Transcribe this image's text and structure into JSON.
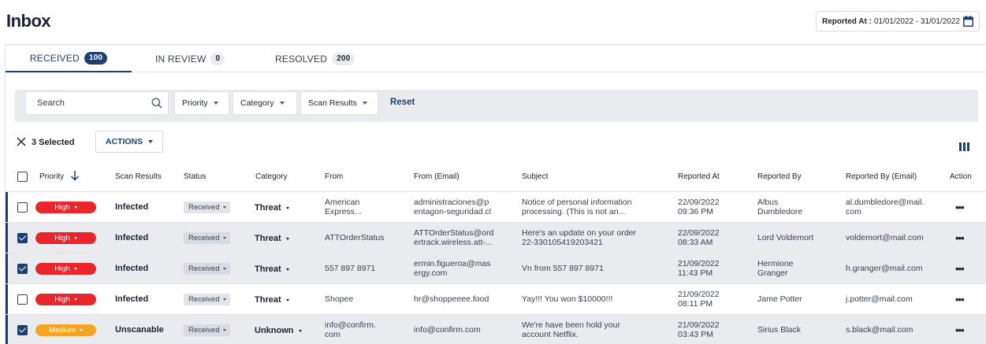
{
  "header": {
    "title": "Inbox",
    "reported_at_label": "Reported At :",
    "reported_at_value": "01/01/2022 - 31/01/2022",
    "calendar_icon": "calendar-icon"
  },
  "tabs": [
    {
      "label": "RECEIVED",
      "count": "100",
      "active": true
    },
    {
      "label": "IN REVIEW",
      "count": "0",
      "active": false
    },
    {
      "label": "RESOLVED",
      "count": "200",
      "active": false
    }
  ],
  "filters": {
    "search_placeholder": "Search",
    "priority_label": "Priority",
    "category_label": "Category",
    "scan_results_label": "Scan Results",
    "reset_label": "Reset"
  },
  "selection": {
    "selected_text": "3 Selected",
    "actions_label": "ACTIONS"
  },
  "columns": [
    "Priority",
    "Scan Results",
    "Status",
    "Category",
    "From",
    "From (Email)",
    "Subject",
    "Reported At",
    "Reported By",
    "Reported By (Email)",
    "Action"
  ],
  "rows": [
    {
      "checked": false,
      "priority": "High",
      "priority_color": "#e8262b",
      "scan": "Infected",
      "status": "Received",
      "category": "Threat",
      "from": [
        "American",
        "Express..."
      ],
      "from_email": [
        "administraciones@p",
        "entagon-seguridad.cl"
      ],
      "subject": [
        "Notice of personal information",
        "processing. (This is not an..."
      ],
      "reported_at": [
        "22/09/2022",
        "09:36 PM"
      ],
      "reported_by": [
        "Albus",
        "Dumbledore"
      ],
      "reported_by_email": [
        "al.dumbledore@mail.",
        "com"
      ]
    },
    {
      "checked": true,
      "priority": "High",
      "priority_color": "#e8262b",
      "scan": "Infected",
      "status": "Received",
      "category": "Threat",
      "from": [
        "ATTOrderStatus"
      ],
      "from_email": [
        "ATTOrderStatus@ord",
        "ertrack.wireless.att-..."
      ],
      "subject": [
        "Here's an update on your order",
        "22-330105419203421"
      ],
      "reported_at": [
        "22/09/2022",
        "08:33 AM"
      ],
      "reported_by": [
        "Lord Voldemort"
      ],
      "reported_by_email": [
        "voldemort@mail.com"
      ]
    },
    {
      "checked": true,
      "priority": "High",
      "priority_color": "#e8262b",
      "scan": "Infected",
      "status": "Received",
      "category": "Threat",
      "from": [
        "557 897 8971"
      ],
      "from_email": [
        "ermin.figueroa@mas",
        "ergy.com"
      ],
      "subject": [
        "Vn from 557 897 8971"
      ],
      "reported_at": [
        "21/09/2022",
        "11:43 PM"
      ],
      "reported_by": [
        "Hermione",
        "Granger"
      ],
      "reported_by_email": [
        "h.granger@mail.com"
      ]
    },
    {
      "checked": false,
      "priority": "High",
      "priority_color": "#e8262b",
      "scan": "Infected",
      "status": "Received",
      "category": "Threat",
      "from": [
        "Shopee"
      ],
      "from_email": [
        "hr@shoppeeee.food"
      ],
      "subject": [
        "Yay!!! You won $10000!!!"
      ],
      "reported_at": [
        "21/09/2022",
        "08:11 PM"
      ],
      "reported_by": [
        "Jame Potter"
      ],
      "reported_by_email": [
        "j.potter@mail.com"
      ]
    },
    {
      "checked": true,
      "priority": "Medium",
      "priority_color": "#f2a623",
      "scan": "Unscanable",
      "status": "Received",
      "category": "Unknown",
      "from": [
        "info@confirm.",
        "com"
      ],
      "from_email": [
        "info@confirm.com"
      ],
      "subject": [
        "We're have been hold your",
        "account Netflix."
      ],
      "reported_at": [
        "21/09/2022",
        "03:43 PM"
      ],
      "reported_by": [
        "Sirius Black"
      ],
      "reported_by_email": [
        "s.black@mail.com"
      ]
    }
  ],
  "row_action_label": "•••"
}
